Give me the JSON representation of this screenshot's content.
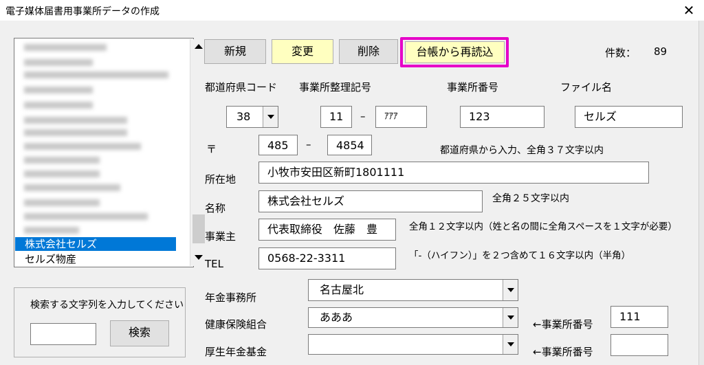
{
  "window": {
    "title": "電子媒体届書用事業所データの作成",
    "close_glyph": "✕"
  },
  "buttons": {
    "new": "新規",
    "change": "変更",
    "delete": "削除",
    "reload": "台帳から再読込"
  },
  "count": {
    "label": "件数：",
    "value": "89"
  },
  "headers": {
    "pref_code": "都道府県コード",
    "reg_symbol": "事業所整理記号",
    "office_number": "事業所番号",
    "file_name": "ファイル名"
  },
  "fields": {
    "pref_code": "38",
    "reg_symbol_1": "11",
    "dash": "–",
    "reg_symbol_2": "ｱｱｱ",
    "office_number": "123",
    "file_name": "セルズ",
    "postal_mark": "〒",
    "postal_1": "485",
    "postal_2": "4854",
    "postal_hint": "都道府県から入力、全角３７文字以内",
    "address_label": "所在地",
    "address": "小牧市安田区新町1801111",
    "name_label": "名称",
    "name": "株式会社セルズ",
    "name_hint": "全角２５文字以内",
    "owner_label": "事業主",
    "owner": "代表取締役　佐藤　豊",
    "owner_hint": "全角１２文字以内（姓と名の間に全角スペースを１文字が必要）",
    "tel_label": "TEL",
    "tel": "0568-22-3311",
    "tel_hint": "「-（ハイフン）」を２つ含めて１６文字以内（半角）",
    "pension_office_label": "年金事務所",
    "pension_office": "名古屋北",
    "health_label": "健康保険組合",
    "health": "あああ",
    "health_num_label": "←事業所番号",
    "health_num": "111",
    "welfare_label": "厚生年金基金",
    "welfare": "",
    "welfare_num_label": "←事業所番号",
    "welfare_num": ""
  },
  "list": {
    "selected": "株式会社セルズ",
    "next": "セルズ物産"
  },
  "search": {
    "label": "検索する文字列を入力してください",
    "button": "検索",
    "value": ""
  },
  "colors": {
    "highlight_border": "#e600c8",
    "selection": "#0078d7",
    "yellow_button": "#ffffc0"
  }
}
